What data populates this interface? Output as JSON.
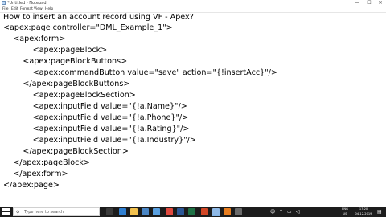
{
  "window": {
    "title": "*Untitled - Notepad",
    "controls": {
      "minimize": "—",
      "maximize": "☐",
      "close": "✕"
    }
  },
  "menu": {
    "items": [
      "File",
      "Edit",
      "Format",
      "View",
      "Help"
    ]
  },
  "editor": {
    "lines": [
      "How to insert an account record using VF - Apex?",
      "<apex:page controller=\"DML_Example_1\">",
      "    <apex:form>",
      "            <apex:pageBlock>",
      "        <apex:pageBlockButtons>",
      "            <apex:commandButton value=\"save\" action=\"{!insertAcc}\"/>",
      "        </apex:pageBlockButtons>",
      "            <apex:pageBlockSection>",
      "            <apex:inputField value=\"{!a.Name}\"/>",
      "            <apex:inputField value=\"{!a.Phone}\"/>",
      "            <apex:inputField value=\"{!a.Rating}\"/>",
      "            <apex:inputField value=\"{!a.Industry}\"/>",
      "        </apex:pageBlockSection>",
      "    </apex:pageBlock>",
      "    </apex:form>",
      "</apex:page>"
    ]
  },
  "taskbar": {
    "search_placeholder": "Type here to search",
    "apps": [
      {
        "icon": "task-view-icon",
        "color": "#3a3a3a"
      },
      {
        "icon": "edge-icon",
        "color": "#2f7fd1"
      },
      {
        "icon": "file-explorer-icon",
        "color": "#f2c14e"
      },
      {
        "icon": "store-icon",
        "color": "#4a86c5"
      },
      {
        "icon": "mail-icon",
        "color": "#5aa0e0"
      },
      {
        "icon": "chrome-icon",
        "color": "#e0493e"
      },
      {
        "icon": "word-icon",
        "color": "#2b5797"
      },
      {
        "icon": "excel-icon",
        "color": "#1e7145"
      },
      {
        "icon": "powerpoint-icon",
        "color": "#d24726"
      },
      {
        "icon": "notepad-icon",
        "color": "#8fb9e6"
      },
      {
        "icon": "media-icon",
        "color": "#e87d1e"
      },
      {
        "icon": "app-icon",
        "color": "#6a6a6a"
      }
    ],
    "tray": {
      "lang_top": "ENG",
      "lang_bottom": "US",
      "time": "17:20",
      "date": "04-12-2019"
    }
  }
}
